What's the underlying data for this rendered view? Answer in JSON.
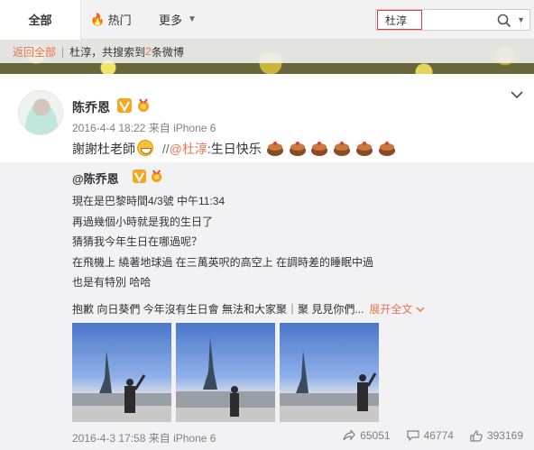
{
  "tabs": {
    "all": "全部",
    "hot": "热门",
    "more": "更多"
  },
  "search": {
    "value": "杜淳"
  },
  "crumbs": {
    "back": "返回全部",
    "sep": "|",
    "query": "杜淳，共搜索到",
    "count": "2",
    "suffix": "条微博"
  },
  "post": {
    "author": "陈乔恩",
    "meta": "2016-4-4 18:22 来自 iPhone 6",
    "text": "謝謝杜老師",
    "slashes": "//",
    "mention": "@杜淳",
    "text2": ":生日快乐"
  },
  "quote": {
    "author": "@陈乔恩",
    "lines": [
      "現在是巴黎時間4/3號 中午11:34",
      "再過幾個小時就是我的生日了",
      "猜猜我今年生日在哪過呢？",
      "在飛機上 繞著地球過 在三萬英呎的高空上 在調時差的睡眠中過",
      "也是有特別 哈哈"
    ],
    "tail": "抱歉 向日葵們 今年沒有生日會 無法和大家聚｜聚 見見你們...",
    "expand": "展开全文",
    "meta": "2016-4-3 17:58 来自 iPhone 6",
    "shares": "65051",
    "comments": "46774",
    "likes": "393169"
  },
  "colors": {
    "accent": "#eb7350",
    "verified": "#f6a623"
  },
  "icons": [
    "fire-icon",
    "caret-down-icon",
    "search-icon",
    "verified-icon",
    "medal-icon",
    "chevron-down-icon",
    "grin-emoji-icon",
    "cake-emoji-icon",
    "share-icon",
    "comment-icon",
    "like-icon"
  ]
}
